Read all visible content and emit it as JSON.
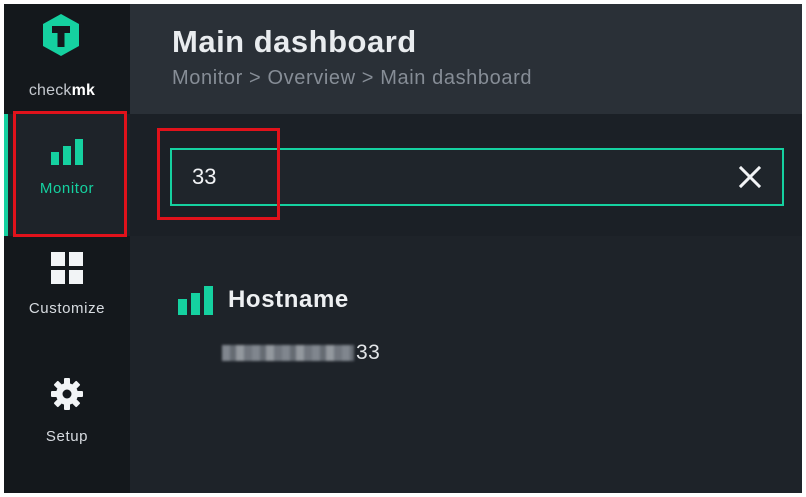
{
  "app": {
    "brand_prefix": "check",
    "brand_suffix": "mk",
    "accent_color": "#15d1a0"
  },
  "sidebar": {
    "items": [
      {
        "label": "Monitor",
        "icon": "bar-chart-icon",
        "active": true
      },
      {
        "label": "Customize",
        "icon": "grid-icon",
        "active": false
      },
      {
        "label": "Setup",
        "icon": "gear-icon",
        "active": false
      }
    ]
  },
  "header": {
    "title": "Main dashboard",
    "breadcrumb": "Monitor > Overview > Main dashboard"
  },
  "search": {
    "value": "33",
    "placeholder": ""
  },
  "results": {
    "group_title": "Hostname",
    "items": [
      {
        "visible_suffix": "33"
      }
    ]
  }
}
